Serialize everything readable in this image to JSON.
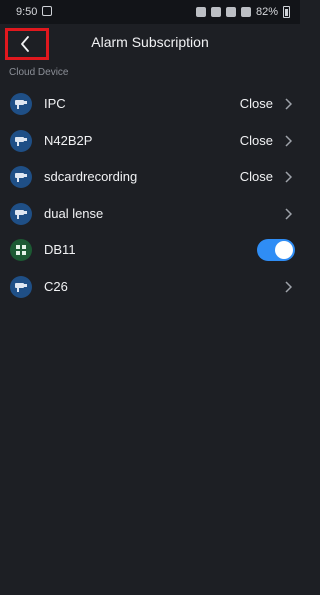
{
  "status_bar": {
    "time": "9:50",
    "battery": "82%"
  },
  "header": {
    "title": "Alarm Subscription",
    "back_icon": "chevron-left-icon"
  },
  "section": {
    "label": "Cloud Device"
  },
  "colors": {
    "background": "#1d1f24",
    "accent": "#2f8df5",
    "highlight_border": "#e0181e"
  },
  "devices": [
    {
      "name": "IPC",
      "status": "Close",
      "icon": "camera-icon",
      "control": "chevron"
    },
    {
      "name": "N42B2P",
      "status": "Close",
      "icon": "camera-icon",
      "control": "chevron"
    },
    {
      "name": "sdcardrecording",
      "status": "Close",
      "icon": "camera-icon",
      "control": "chevron"
    },
    {
      "name": "dual lense",
      "status": "",
      "icon": "camera-icon",
      "control": "chevron"
    },
    {
      "name": "DB11",
      "status": "",
      "icon": "doorbell-grid-icon",
      "control": "toggle",
      "toggle_on": true
    },
    {
      "name": "C26",
      "status": "",
      "icon": "camera-icon",
      "control": "chevron"
    }
  ]
}
